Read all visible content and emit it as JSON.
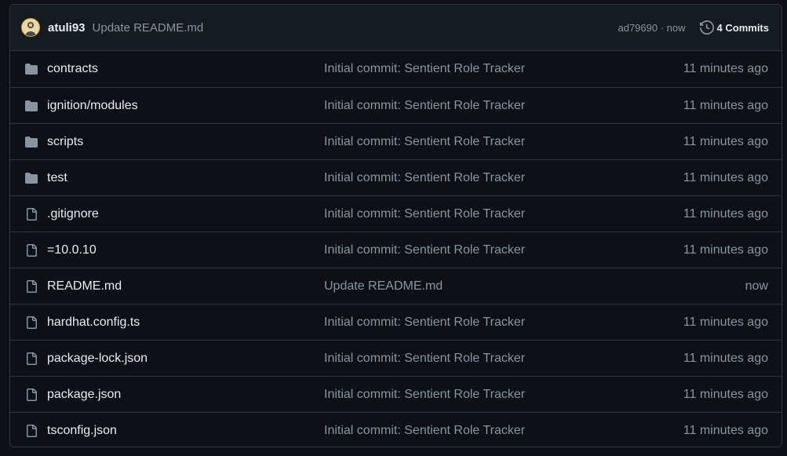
{
  "header": {
    "author": "atuli93",
    "message": "Update README.md",
    "sha": "ad79690",
    "separator": " · ",
    "when": "now",
    "commits_label": "4 Commits",
    "icon": "history-icon"
  },
  "files": [
    {
      "name": "contracts",
      "type": "folder",
      "message": "Initial commit: Sentient Role Tracker",
      "time": "11 minutes ago"
    },
    {
      "name": "ignition/modules",
      "type": "folder",
      "message": "Initial commit: Sentient Role Tracker",
      "time": "11 minutes ago"
    },
    {
      "name": "scripts",
      "type": "folder",
      "message": "Initial commit: Sentient Role Tracker",
      "time": "11 minutes ago"
    },
    {
      "name": "test",
      "type": "folder",
      "message": "Initial commit: Sentient Role Tracker",
      "time": "11 minutes ago"
    },
    {
      "name": ".gitignore",
      "type": "file",
      "message": "Initial commit: Sentient Role Tracker",
      "time": "11 minutes ago"
    },
    {
      "name": "=10.0.10",
      "type": "file",
      "message": "Initial commit: Sentient Role Tracker",
      "time": "11 minutes ago"
    },
    {
      "name": "README.md",
      "type": "file",
      "message": "Update README.md",
      "time": "now"
    },
    {
      "name": "hardhat.config.ts",
      "type": "file",
      "message": "Initial commit: Sentient Role Tracker",
      "time": "11 minutes ago"
    },
    {
      "name": "package-lock.json",
      "type": "file",
      "message": "Initial commit: Sentient Role Tracker",
      "time": "11 minutes ago"
    },
    {
      "name": "package.json",
      "type": "file",
      "message": "Initial commit: Sentient Role Tracker",
      "time": "11 minutes ago"
    },
    {
      "name": "tsconfig.json",
      "type": "file",
      "message": "Initial commit: Sentient Role Tracker",
      "time": "11 minutes ago"
    }
  ],
  "colors": {
    "background": "#0d1117",
    "header_bg": "#161b22",
    "border": "#30363d",
    "text": "#e6edf3",
    "muted": "#8b949e",
    "folder_icon": "#8b949e"
  }
}
